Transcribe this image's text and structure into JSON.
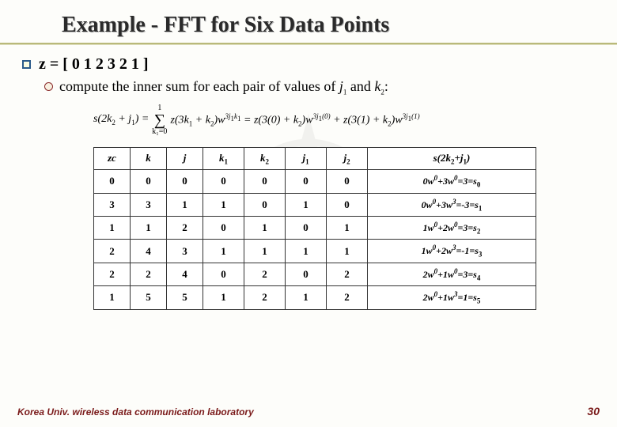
{
  "title": "Example - FFT for Six Data Points",
  "z_line": "z = [ 0 1 2 3 2 1 ]",
  "sub_text_pre": "compute the inner sum for each pair of values of ",
  "sub_j1": "j",
  "sub_j1_sub": "1",
  "sub_and": " and ",
  "sub_k2": "k",
  "sub_k2_sub": "2",
  "sub_colon": ":",
  "formula_text": "s(2k₂ + j₁) =  Σ  z(3k₁ + k₂)w³ʲ¹ᵏ¹ = z(3(0) + k₂)w³ʲ¹⁽⁰⁾ + z(3(1) + k₂)w³ʲ¹⁽¹⁾",
  "sigma_top": "1",
  "sigma_bot": "k₁=0",
  "headers": {
    "zc": "zc",
    "k": "k",
    "j": "j",
    "k1": "k",
    "k1_sub": "1",
    "k2": "k",
    "k2_sub": "2",
    "j1": "j",
    "j1_sub": "1",
    "j2": "j",
    "j2_sub": "2",
    "s": "s(2k",
    "s_sub1": "2",
    "s_mid": "+j",
    "s_sub2": "1",
    "s_end": ")"
  },
  "rows": [
    {
      "zc": "0",
      "k": "0",
      "j": "0",
      "k1": "0",
      "k2": "0",
      "j1": "0",
      "j2": "0",
      "res": "0w⁰+3w⁰=3=s₀"
    },
    {
      "zc": "3",
      "k": "3",
      "j": "1",
      "k1": "1",
      "k2": "0",
      "j1": "1",
      "j2": "0",
      "res": "0w⁰+3w³=-3=s₁"
    },
    {
      "zc": "1",
      "k": "1",
      "j": "2",
      "k1": "0",
      "k2": "1",
      "j1": "0",
      "j2": "1",
      "res": "1w⁰+2w⁰=3=s₂"
    },
    {
      "zc": "2",
      "k": "4",
      "j": "3",
      "k1": "1",
      "k2": "1",
      "j1": "1",
      "j2": "1",
      "res": "1w⁰+2w³=-1=s₃"
    },
    {
      "zc": "2",
      "k": "2",
      "j": "4",
      "k1": "0",
      "k2": "2",
      "j1": "0",
      "j2": "2",
      "res": "2w⁰+1w⁰=3=s₄"
    },
    {
      "zc": "1",
      "k": "5",
      "j": "5",
      "k1": "1",
      "k2": "2",
      "j1": "1",
      "j2": "2",
      "res": "2w⁰+1w³=1=s₅"
    }
  ],
  "footer_left": "Korea Univ. wireless data communication laboratory",
  "footer_right": "30"
}
